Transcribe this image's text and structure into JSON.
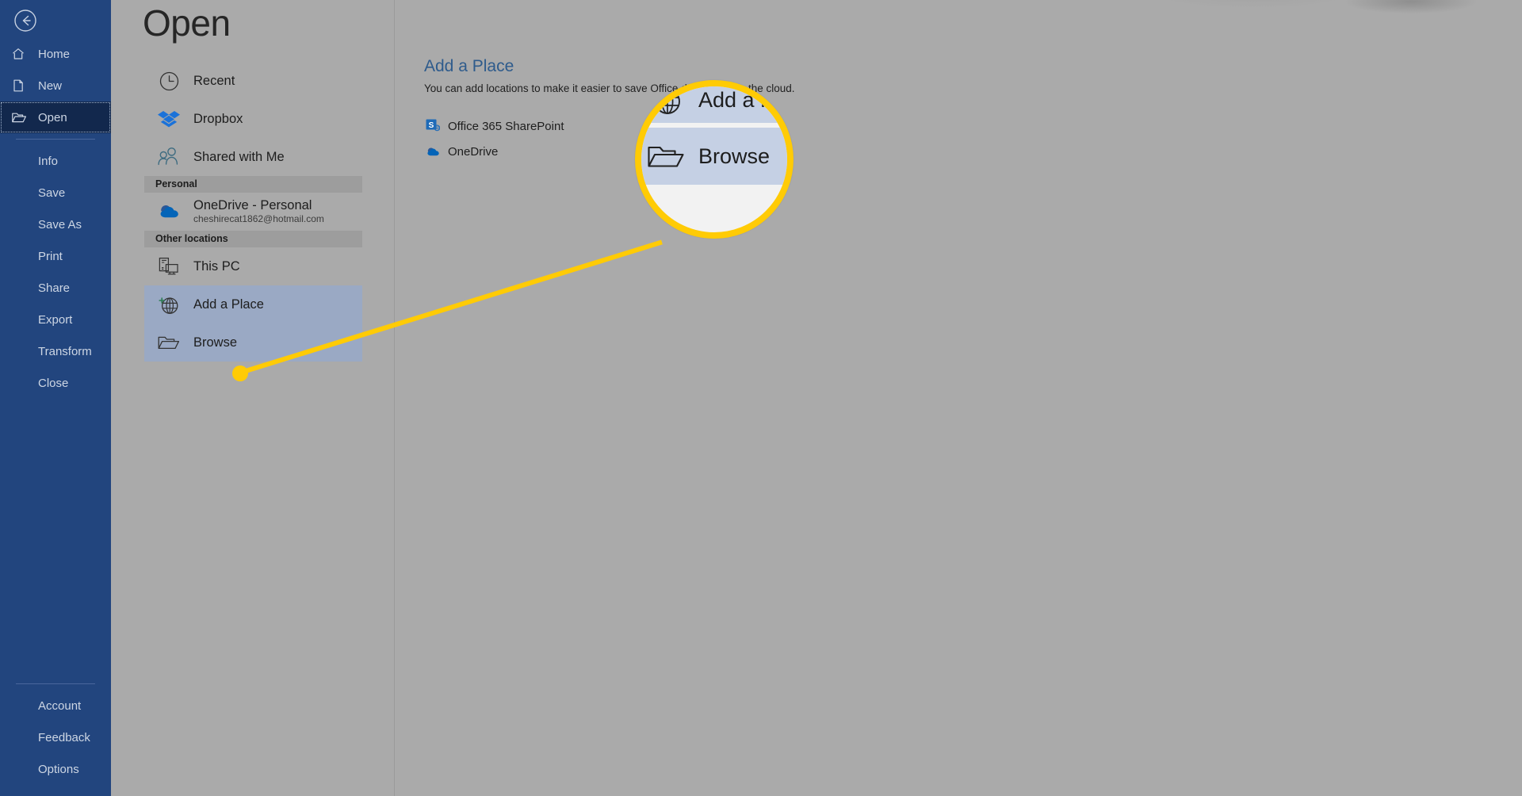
{
  "window": {
    "app": "Microsoft Word Backstage",
    "page_title": "Open",
    "accent_color": "#22457e",
    "callout_color": "#ffcb05",
    "panel_bg": "#aaaaaa",
    "highlight_color": "#9aa9c4"
  },
  "rail": {
    "back_icon": "back-arrow-icon",
    "primary": [
      {
        "label": "Home",
        "icon": "home-icon",
        "selected": false
      },
      {
        "label": "New",
        "icon": "new-document-icon",
        "selected": false
      },
      {
        "label": "Open",
        "icon": "open-folder-icon",
        "selected": true
      }
    ],
    "secondary": [
      {
        "label": "Info"
      },
      {
        "label": "Save"
      },
      {
        "label": "Save As"
      },
      {
        "label": "Print"
      },
      {
        "label": "Share"
      },
      {
        "label": "Export"
      },
      {
        "label": "Transform"
      },
      {
        "label": "Close"
      }
    ],
    "bottom": [
      {
        "label": "Account"
      },
      {
        "label": "Feedback"
      },
      {
        "label": "Options"
      }
    ]
  },
  "places": {
    "top": [
      {
        "label": "Recent",
        "icon": "clock-icon",
        "highlight": false
      },
      {
        "label": "Dropbox",
        "icon": "dropbox-icon",
        "highlight": false
      },
      {
        "label": "Shared with Me",
        "icon": "people-icon",
        "highlight": false
      }
    ],
    "group_personal": "Personal",
    "personal": [
      {
        "label": "OneDrive - Personal",
        "sub": "cheshirecat1862@hotmail.com",
        "icon": "onedrive-icon",
        "highlight": false
      }
    ],
    "group_other": "Other locations",
    "other": [
      {
        "label": "This PC",
        "icon": "this-pc-icon",
        "highlight": false
      },
      {
        "label": "Add a Place",
        "icon": "add-a-place-globe-icon",
        "highlight": true
      },
      {
        "label": "Browse",
        "icon": "browse-folder-icon",
        "highlight": true
      }
    ]
  },
  "right_panel": {
    "title": "Add a Place",
    "description": "You can add locations to make it easier to save Office documents to the cloud.",
    "services": [
      {
        "label": "Office 365 SharePoint",
        "icon": "sharepoint-icon"
      },
      {
        "label": "OneDrive",
        "icon": "onedrive-icon"
      }
    ]
  },
  "magnifier": {
    "rows": [
      {
        "label": "Add a Place",
        "icon": "add-a-place-globe-icon"
      },
      {
        "label": "Browse",
        "icon": "browse-folder-icon"
      }
    ]
  }
}
